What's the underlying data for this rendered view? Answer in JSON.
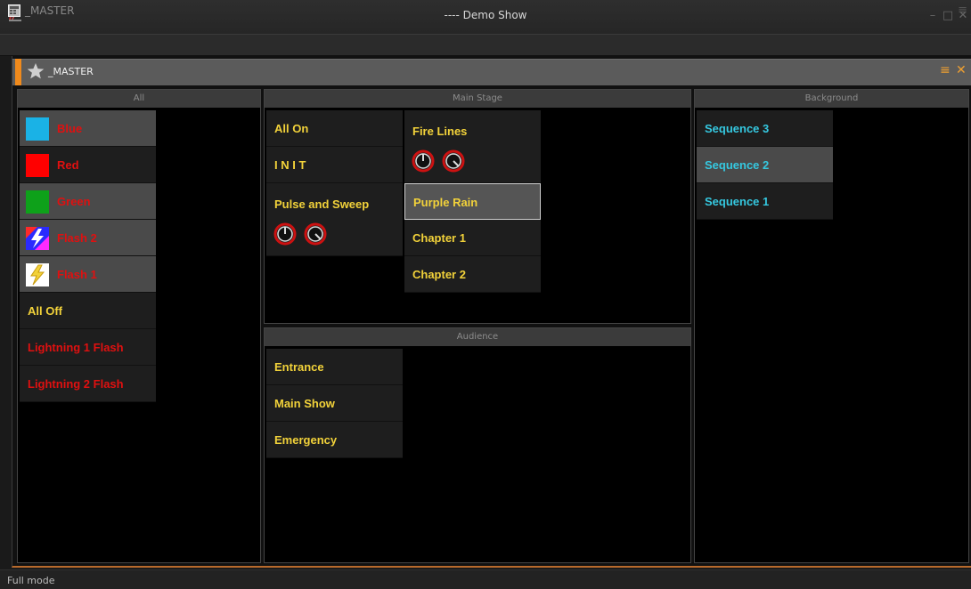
{
  "window": {
    "title": "---- Demo Show",
    "minimize": "–",
    "maximize": "□",
    "close": "✕"
  },
  "master_bar": {
    "title": "_MASTER",
    "menu": "≡"
  },
  "inner": {
    "title": "_MASTER",
    "menu": "≡",
    "close": "✕"
  },
  "colors": {
    "accent": "#f08a1c",
    "yellow": "#f2d23a",
    "red": "#e01010",
    "cyan": "#35c8e0"
  },
  "panels": {
    "all": {
      "title": "All",
      "items": [
        {
          "label": "Blue",
          "swatch": "#1ab2e6",
          "color": "#e01010"
        },
        {
          "label": "Red",
          "swatch": "#ff0000",
          "color": "#e01010"
        },
        {
          "label": "Green",
          "swatch": "#0ea11a",
          "color": "#e01010"
        },
        {
          "label": "Flash 2",
          "icon": "flash-2-icon",
          "color": "#e01010"
        },
        {
          "label": "Flash 1",
          "icon": "lightning-icon",
          "color": "#e01010"
        },
        {
          "label": "All Off",
          "color": "#f2d23a"
        },
        {
          "label": "Lightning 1 Flash",
          "color": "#e01010"
        },
        {
          "label": "Lightning 2 Flash",
          "color": "#e01010"
        }
      ]
    },
    "main_stage": {
      "title": "Main Stage",
      "col1": [
        {
          "label": "All On"
        },
        {
          "label": "I N I T"
        },
        {
          "label": "Pulse and Sweep",
          "knobs": true
        }
      ],
      "col2": [
        {
          "label": "Fire Lines",
          "knobs": true
        },
        {
          "label": "Purple Rain",
          "active": true
        },
        {
          "label": "Chapter 1"
        },
        {
          "label": "Chapter 2"
        }
      ]
    },
    "audience": {
      "title": "Audience",
      "items": [
        {
          "label": "Entrance"
        },
        {
          "label": "Main Show"
        },
        {
          "label": "Emergency"
        }
      ]
    },
    "background": {
      "title": "Background",
      "items": [
        {
          "label": "Sequence 3"
        },
        {
          "label": "Sequence 2",
          "selected": true
        },
        {
          "label": "Sequence 1"
        }
      ]
    }
  },
  "status": {
    "text": "Full mode"
  }
}
